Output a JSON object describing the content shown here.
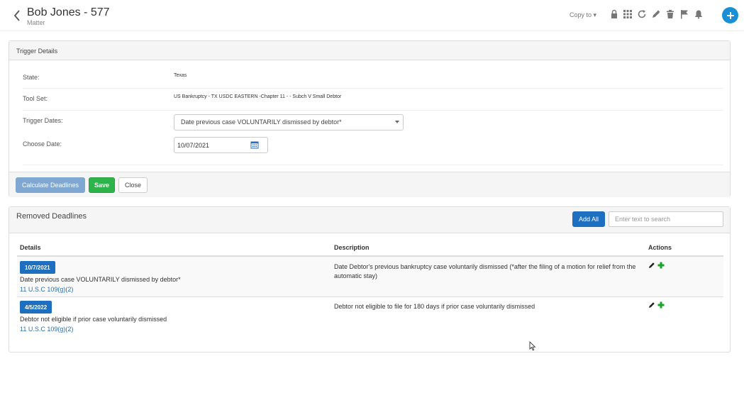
{
  "header": {
    "title": "Bob Jones - 577",
    "subtitle": "Matter",
    "copy_to": "Copy to ▾",
    "icons": [
      "lock-icon",
      "grid-icon",
      "refresh-icon",
      "pencil-icon",
      "trash-icon",
      "flag-icon",
      "bell-icon"
    ]
  },
  "trigger": {
    "heading": "Trigger Details",
    "state_label": "State:",
    "state_value": "Texas",
    "toolset_label": "Tool Set:",
    "toolset_value": "US Bankruptcy - TX USDC EASTERN -Chapter 11 - - Subch V Small Debtor",
    "trigger_dates_label": "Trigger Dates:",
    "trigger_dates_value": "Date previous case VOLUNTARILY dismissed by debtor*",
    "choose_date_label": "Choose Date:",
    "choose_date_value": "10/07/2021",
    "calc_label": "Calculate Deadlines",
    "save_label": "Save",
    "close_label": "Close"
  },
  "removed": {
    "heading": "Removed Deadlines",
    "add_all_label": "Add All",
    "search_placeholder": "Enter text to search",
    "columns": {
      "details": "Details",
      "description": "Description",
      "actions": "Actions"
    },
    "rows": [
      {
        "date": "10/7/2021",
        "detail": "Date previous case VOLUNTARILY dismissed by debtor*",
        "rule": "11 U.S.C 109(g)(2)",
        "description": "Date Debtor's previous bankruptcy case voluntarily dismissed (*after the filing of a motion for relief from the automatic stay)"
      },
      {
        "date": "4/5/2022",
        "detail": "Debtor not eligible if prior case voluntarily dismissed",
        "rule": "11 U.S.C 109(g)(2)",
        "description": "Debtor not eligible to file for 180 days if prior case voluntarily dismissed"
      }
    ]
  },
  "colors": {
    "accent_blue": "#1f6fc0",
    "fab_blue": "#1a8fd6",
    "save_green": "#2db34a",
    "calc_blue": "#7fa7d1",
    "link_blue": "#2a6eb8",
    "plus_green": "#1aa32a"
  }
}
